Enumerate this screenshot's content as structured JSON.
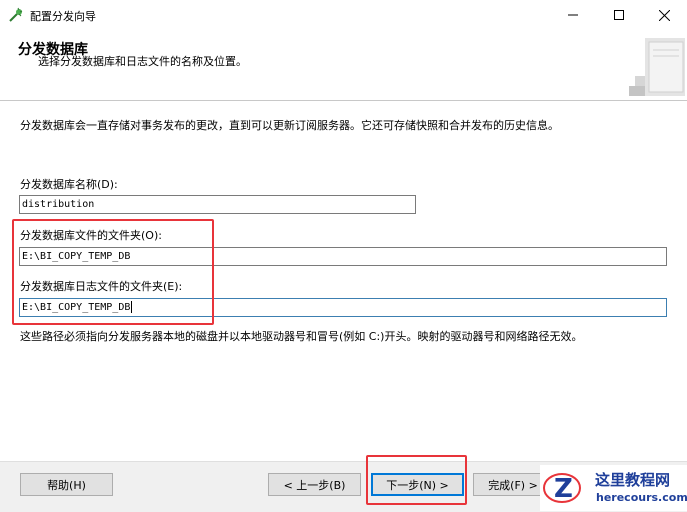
{
  "window": {
    "title": "配置分发向导"
  },
  "header": {
    "title": "分发数据库",
    "subtitle": "选择分发数据库和日志文件的名称及位置。"
  },
  "body": {
    "description": "分发数据库会一直存储对事务发布的更改，直到可以更新订阅服务器。它还可存储快照和合并发布的历史信息。",
    "db_name_label": "分发数据库名称(D):",
    "db_name_value": "distribution",
    "data_folder_label": "分发数据库文件的文件夹(O):",
    "data_folder_value": "E:\\BI_COPY_TEMP_DB",
    "log_folder_label": "分发数据库日志文件的文件夹(E):",
    "log_folder_value": "E:\\BI_COPY_TEMP_DB",
    "note": "这些路径必须指向分发服务器本地的磁盘并以本地驱动器号和冒号(例如 C:)开头。映射的驱动器号和网络路径无效。"
  },
  "footer": {
    "help_label": "帮助(H)",
    "back_label": "< 上一步(B)",
    "next_label": "下一步(N) >",
    "finish_label": "完成(F) >"
  },
  "watermark": {
    "name": "这里教程网",
    "url": "herecours.com"
  },
  "colors": {
    "highlight": "#e8343a",
    "focus_border": "#3c7fb1",
    "default_button_border": "#0078d7",
    "watermark_text": "#1f3f9a"
  }
}
